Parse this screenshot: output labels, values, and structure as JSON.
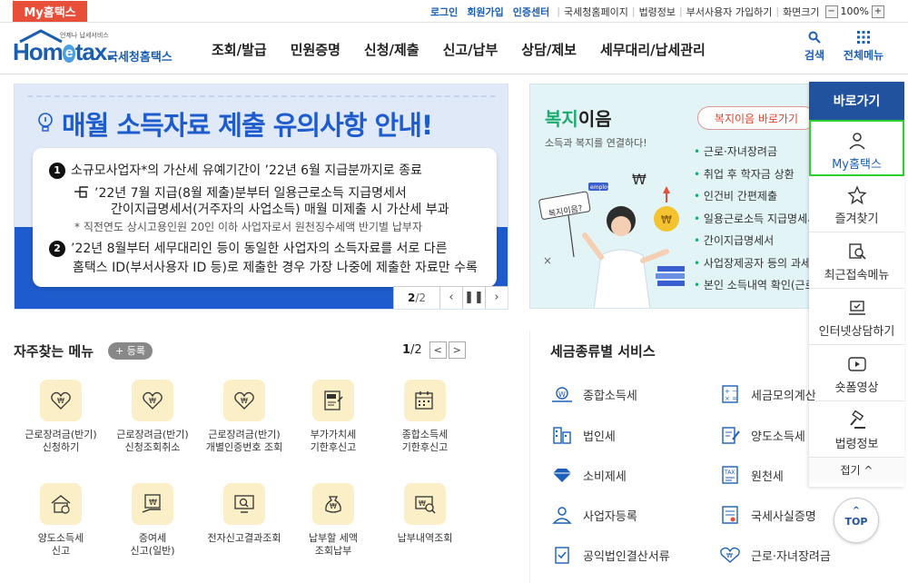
{
  "topbar": {
    "myhome_tab": "My홈택스",
    "links_blue": [
      "로그인",
      "회원가입",
      "인증센터"
    ],
    "links_gray": [
      "국세청홈페이지",
      "법령정보",
      "부서사용자 가입하기",
      "화면크기"
    ],
    "zoom": "100%",
    "zoom_minus": "−",
    "zoom_plus": "+"
  },
  "header": {
    "logo_sub": "언제나 납세서비스",
    "logo_main_pre": "Hom",
    "logo_main_e": "e",
    "logo_main_post": "tax.",
    "logo_kr": "국세청홈택스",
    "gnb": [
      "조회/발급",
      "민원증명",
      "신청/제출",
      "신고/납부",
      "상담/제보",
      "세무대리/납세관리"
    ],
    "search_label": "검색",
    "allmenu_label": "전체메뉴"
  },
  "banner": {
    "title": "매월 소득자료 제출 유의사항 안내!",
    "line1_num": "1",
    "line1": "소규모사업자*의 가산세 유예기간이 ’22년 6월 지급분까지로 종료",
    "line1b": "’22년 7월 지급(8월 제출)분부터 일용근로소득 지급명세서",
    "line1c": "간이지급명세서(거주자의 사업소득) 매월 미제출 시 가산세 부과",
    "note": "* 직전연도 상시고용인원 20인 이하 사업자로서 원천징수세액 반기별 납부자",
    "line2_num": "2",
    "line2": "’22년 8월부터 세무대리인 등이 동일한 사업자의 소득자료를 서로 다른",
    "line2b": "홈택스 ID(부서사용자 ID 등)로 제출한 경우 가장 나중에 제출한 자료만 수록",
    "page_current": "2",
    "page_total": "/2"
  },
  "welfare": {
    "title_green": "복지",
    "title_rest": "이음",
    "subtitle": "소득과 복지를 연결하다!",
    "button": "복지이음 바로가기",
    "items": [
      "근로·자녀장려금",
      "취업 후 학자금 상환",
      "인건비 간편제출",
      "일용근로소득 지급명세서",
      "간이지급명세서",
      "사업장제공자 등의 과세자료",
      "본인 소득내역 확인(근로)"
    ],
    "sign": "복지이음?",
    "tag": "employ"
  },
  "quicknav": {
    "head": "바로가기",
    "items": [
      "My홈택스",
      "즐겨찾기",
      "최근접속메뉴",
      "인터넷상담하기",
      "숏폼영상",
      "법령정보"
    ],
    "fold": "접기 ^"
  },
  "top_button": "TOP",
  "frequent": {
    "title": "자주찾는 메뉴",
    "add": "+ 등록",
    "page_current": "1",
    "page_total": "/2",
    "items": [
      {
        "l1": "근로장려금(반기)",
        "l2": "신청하기"
      },
      {
        "l1": "근로장려금(반기)",
        "l2": "신청조회취소"
      },
      {
        "l1": "근로장려금(반기)",
        "l2": "개별인증번호 조회"
      },
      {
        "l1": "부가가치세",
        "l2": "기한후신고"
      },
      {
        "l1": "종합소득세",
        "l2": "기한후신고"
      },
      {
        "l1": "양도소득세",
        "l2": "신고"
      },
      {
        "l1": "증여세",
        "l2": "신고(일반)"
      },
      {
        "l1": "전자신고결과조회",
        "l2": ""
      },
      {
        "l1": "납부할 세액",
        "l2": "조회납부"
      },
      {
        "l1": "납부내역조회",
        "l2": ""
      }
    ]
  },
  "taxservice": {
    "title": "세금종류별 서비스",
    "left": [
      "종합소득세",
      "법인세",
      "소비제세",
      "사업자등록",
      "공익법인결산서류"
    ],
    "right": [
      "세금모의계산",
      "양도소득세",
      "원천세",
      "국세사실증명",
      "근로·자녀장려금"
    ]
  },
  "colors": {
    "accent_blue": "#1c5fb8",
    "brand_red": "#e84f3b",
    "banner_blue": "#1e5ccd",
    "quick_head": "#21529e",
    "active_green": "#2dd12d"
  }
}
